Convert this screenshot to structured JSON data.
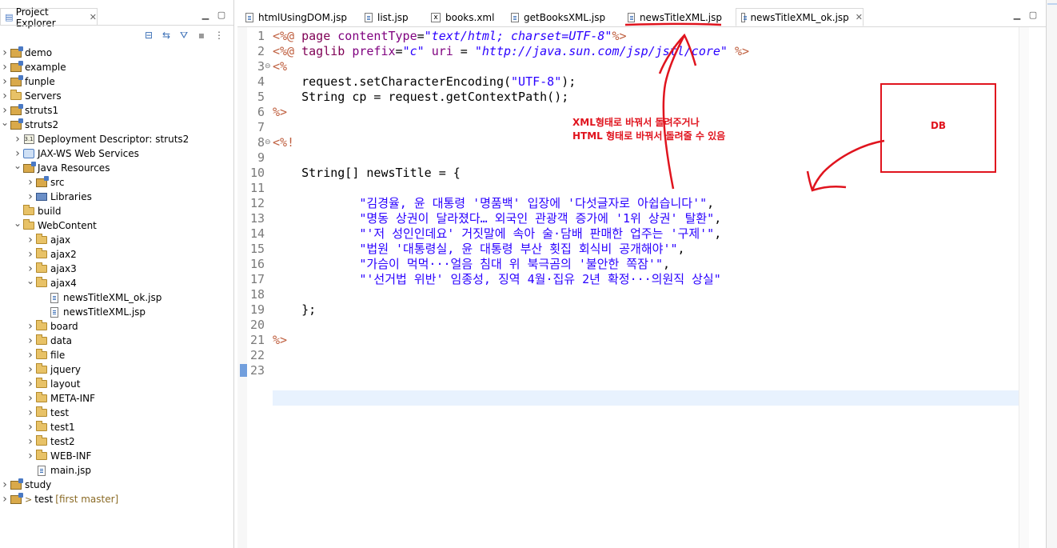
{
  "explorer": {
    "title": "Project Explorer",
    "tree": [
      {
        "label": "demo",
        "kind": "project",
        "depth": 0,
        "expanded": false
      },
      {
        "label": "example",
        "kind": "project",
        "depth": 0,
        "expanded": false
      },
      {
        "label": "funple",
        "kind": "project",
        "depth": 0,
        "expanded": false
      },
      {
        "label": "Servers",
        "kind": "folder",
        "depth": 0,
        "expanded": false
      },
      {
        "label": "struts1",
        "kind": "project",
        "depth": 0,
        "expanded": false
      },
      {
        "label": "struts2",
        "kind": "project",
        "depth": 0,
        "expanded": true
      },
      {
        "label": "Deployment Descriptor: struts2",
        "kind": "descriptor",
        "depth": 1,
        "expanded": false
      },
      {
        "label": "JAX-WS Web Services",
        "kind": "webservice",
        "depth": 1,
        "expanded": false
      },
      {
        "label": "Java Resources",
        "kind": "javares",
        "depth": 1,
        "expanded": true
      },
      {
        "label": "src",
        "kind": "src",
        "depth": 2,
        "expanded": false
      },
      {
        "label": "Libraries",
        "kind": "library",
        "depth": 2,
        "expanded": false
      },
      {
        "label": "build",
        "kind": "folder",
        "depth": 1,
        "leaf": true
      },
      {
        "label": "WebContent",
        "kind": "folder",
        "depth": 1,
        "expanded": true
      },
      {
        "label": "ajax",
        "kind": "folder",
        "depth": 2,
        "expanded": false
      },
      {
        "label": "ajax2",
        "kind": "folder",
        "depth": 2,
        "expanded": false
      },
      {
        "label": "ajax3",
        "kind": "folder",
        "depth": 2,
        "expanded": false
      },
      {
        "label": "ajax4",
        "kind": "folder",
        "depth": 2,
        "expanded": true
      },
      {
        "label": "newsTitleXML_ok.jsp",
        "kind": "file",
        "depth": 3,
        "leaf": true
      },
      {
        "label": "newsTitleXML.jsp",
        "kind": "file",
        "depth": 3,
        "leaf": true
      },
      {
        "label": "board",
        "kind": "folder",
        "depth": 2,
        "expanded": false
      },
      {
        "label": "data",
        "kind": "folder",
        "depth": 2,
        "expanded": false
      },
      {
        "label": "file",
        "kind": "folder",
        "depth": 2,
        "expanded": false
      },
      {
        "label": "jquery",
        "kind": "folder",
        "depth": 2,
        "expanded": false
      },
      {
        "label": "layout",
        "kind": "folder",
        "depth": 2,
        "expanded": false
      },
      {
        "label": "META-INF",
        "kind": "folder",
        "depth": 2,
        "expanded": false
      },
      {
        "label": "test",
        "kind": "folder",
        "depth": 2,
        "expanded": false
      },
      {
        "label": "test1",
        "kind": "folder",
        "depth": 2,
        "expanded": false
      },
      {
        "label": "test2",
        "kind": "folder",
        "depth": 2,
        "expanded": false
      },
      {
        "label": "WEB-INF",
        "kind": "folder",
        "depth": 2,
        "expanded": false
      },
      {
        "label": "main.jsp",
        "kind": "file",
        "depth": 2,
        "leaf": true
      },
      {
        "label": "study",
        "kind": "project",
        "depth": 0,
        "expanded": false
      },
      {
        "label": "test",
        "kind": "gitproject",
        "depth": 0,
        "expanded": false,
        "git_prefix": ">",
        "git": "[first master]"
      }
    ]
  },
  "editor": {
    "tabs": [
      {
        "label": "htmlUsingDOM.jsp",
        "icon": "jsp-file-icon",
        "active": false
      },
      {
        "label": "list.jsp",
        "icon": "jsp-file-icon",
        "active": false
      },
      {
        "label": "books.xml",
        "icon": "xml-file-icon",
        "active": false
      },
      {
        "label": "getBooksXML.jsp",
        "icon": "jsp-file-icon",
        "active": false
      },
      {
        "label": "newsTitleXML.jsp",
        "icon": "jsp-file-icon",
        "active": false
      },
      {
        "label": "newsTitleXML_ok.jsp",
        "icon": "jsp-file-icon",
        "active": true
      }
    ],
    "lines": [
      [
        [
          "tag",
          "<%@ "
        ],
        [
          "kw",
          "page "
        ],
        [
          "attr",
          "contentType"
        ],
        [
          "plain",
          "="
        ],
        [
          "val",
          "\"text/html; charset=UTF-8\""
        ],
        [
          "tag",
          "%>"
        ]
      ],
      [
        [
          "tag",
          "<%@ "
        ],
        [
          "kw",
          "taglib "
        ],
        [
          "attr",
          "prefix"
        ],
        [
          "plain",
          "="
        ],
        [
          "val",
          "\"c\""
        ],
        [
          "plain",
          " "
        ],
        [
          "attr",
          "uri"
        ],
        [
          "plain",
          " = "
        ],
        [
          "val",
          "\"http://java.sun.com/jsp/jstl/core\""
        ],
        [
          "plain",
          " "
        ],
        [
          "tag",
          "%>"
        ]
      ],
      [
        [
          "tag",
          "<%"
        ]
      ],
      [
        [
          "plain",
          "    request.setCharacterEncoding("
        ],
        [
          "str",
          "\"UTF-8\""
        ],
        [
          "plain",
          ");"
        ]
      ],
      [
        [
          "plain",
          "    String cp = request.getContextPath();"
        ]
      ],
      [
        [
          "tag",
          "%>"
        ]
      ],
      [],
      [
        [
          "tag",
          "<%!"
        ]
      ],
      [],
      [
        [
          "plain",
          "    String[] newsTitle = {"
        ]
      ],
      [],
      [
        [
          "str",
          "            \"김경율, 윤 대통령 '명품백' 입장에 '다섯글자로 아쉽습니다'\""
        ],
        [
          "plain",
          ","
        ]
      ],
      [
        [
          "str",
          "            \"명동 상권이 달라졌다… 외국인 관광객 증가에 '1위 상권' 탈환\""
        ],
        [
          "plain",
          ","
        ]
      ],
      [
        [
          "str",
          "            \"'저 성인인데요' 거짓말에 속아 술·담배 판매한 업주는 '구제'\""
        ],
        [
          "plain",
          ","
        ]
      ],
      [
        [
          "str",
          "            \"법원 '대통령실, 윤 대통령 부산 횟집 회식비 공개해야'\""
        ],
        [
          "plain",
          ","
        ]
      ],
      [
        [
          "str",
          "            \"가슴이 먹먹···얼음 침대 위 북극곰의 '불안한 쪽잠'\""
        ],
        [
          "plain",
          ","
        ]
      ],
      [
        [
          "str",
          "            \"'선거법 위반' 임종성, 징역 4월·집유 2년 확정···의원직 상실\""
        ]
      ],
      [],
      [
        [
          "plain",
          "    };"
        ]
      ],
      [],
      [
        [
          "tag",
          "%>"
        ]
      ],
      [],
      []
    ],
    "line_numbers": [
      "1",
      "2",
      "3",
      "4",
      "5",
      "6",
      "7",
      "8",
      "9",
      "10",
      "11",
      "12",
      "13",
      "14",
      "15",
      "16",
      "17",
      "18",
      "19",
      "20",
      "21",
      "22",
      "23"
    ],
    "current_line": 23
  },
  "annotations": {
    "note_line1": "XML형태로 바꿔서 돌려주거나",
    "note_line2": "HTML 형태로 바꿔서 돌려줄 수 있음",
    "db_label": "DB",
    "color": "#e0141e"
  }
}
